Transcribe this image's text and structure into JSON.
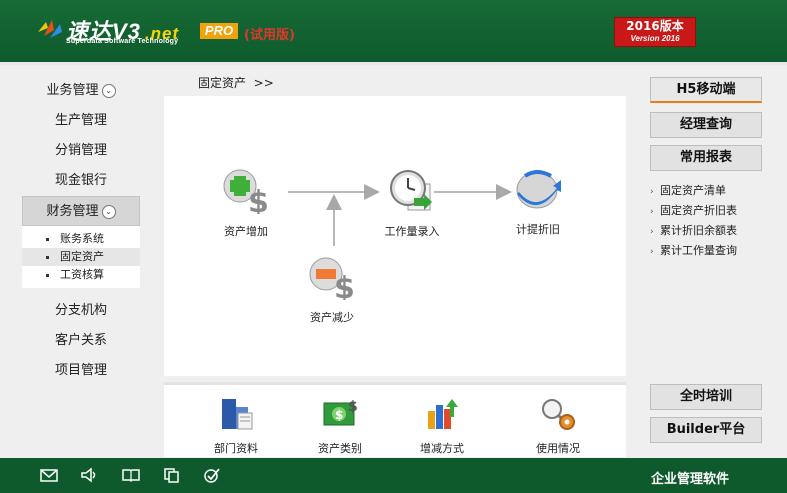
{
  "header": {
    "logo_main": "速达V3",
    "logo_net": ".net",
    "logo_sub": "Superdata Software Technology",
    "pro": "PRO",
    "trial": "(试用版)",
    "version_cn": "2016版本",
    "version_en": "Version 2016"
  },
  "nav": {
    "items": [
      {
        "label": "业务管理"
      },
      {
        "label": "生产管理"
      },
      {
        "label": "分销管理"
      },
      {
        "label": "现金银行"
      },
      {
        "label": "财务管理"
      }
    ],
    "subitems": [
      "账务系统",
      "固定资产",
      "工资核算"
    ],
    "items_after": [
      "分支机构",
      "客户关系",
      "项目管理"
    ]
  },
  "breadcrumb": {
    "label": "固定资产",
    "arrow": ">>"
  },
  "flow": {
    "asset_add": "资产增加",
    "workload": "工作量录入",
    "depreciation": "计提折旧",
    "asset_reduce": "资产减少"
  },
  "tools": [
    "部门资料",
    "资产类别",
    "增减方式",
    "使用情况"
  ],
  "right": {
    "buttons": [
      "H5移动端",
      "经理查询",
      "常用报表"
    ],
    "links": [
      "固定资产清单",
      "固定资产折旧表",
      "累计折旧余额表",
      "累计工作量查询"
    ],
    "bottom_buttons": [
      "全时培训",
      "Builder平台"
    ]
  },
  "footer": {
    "text": "企业管理软件"
  },
  "colors": {
    "header_green": "#166b36",
    "accent_orange": "#e87f14",
    "version_red": "#c81818"
  }
}
